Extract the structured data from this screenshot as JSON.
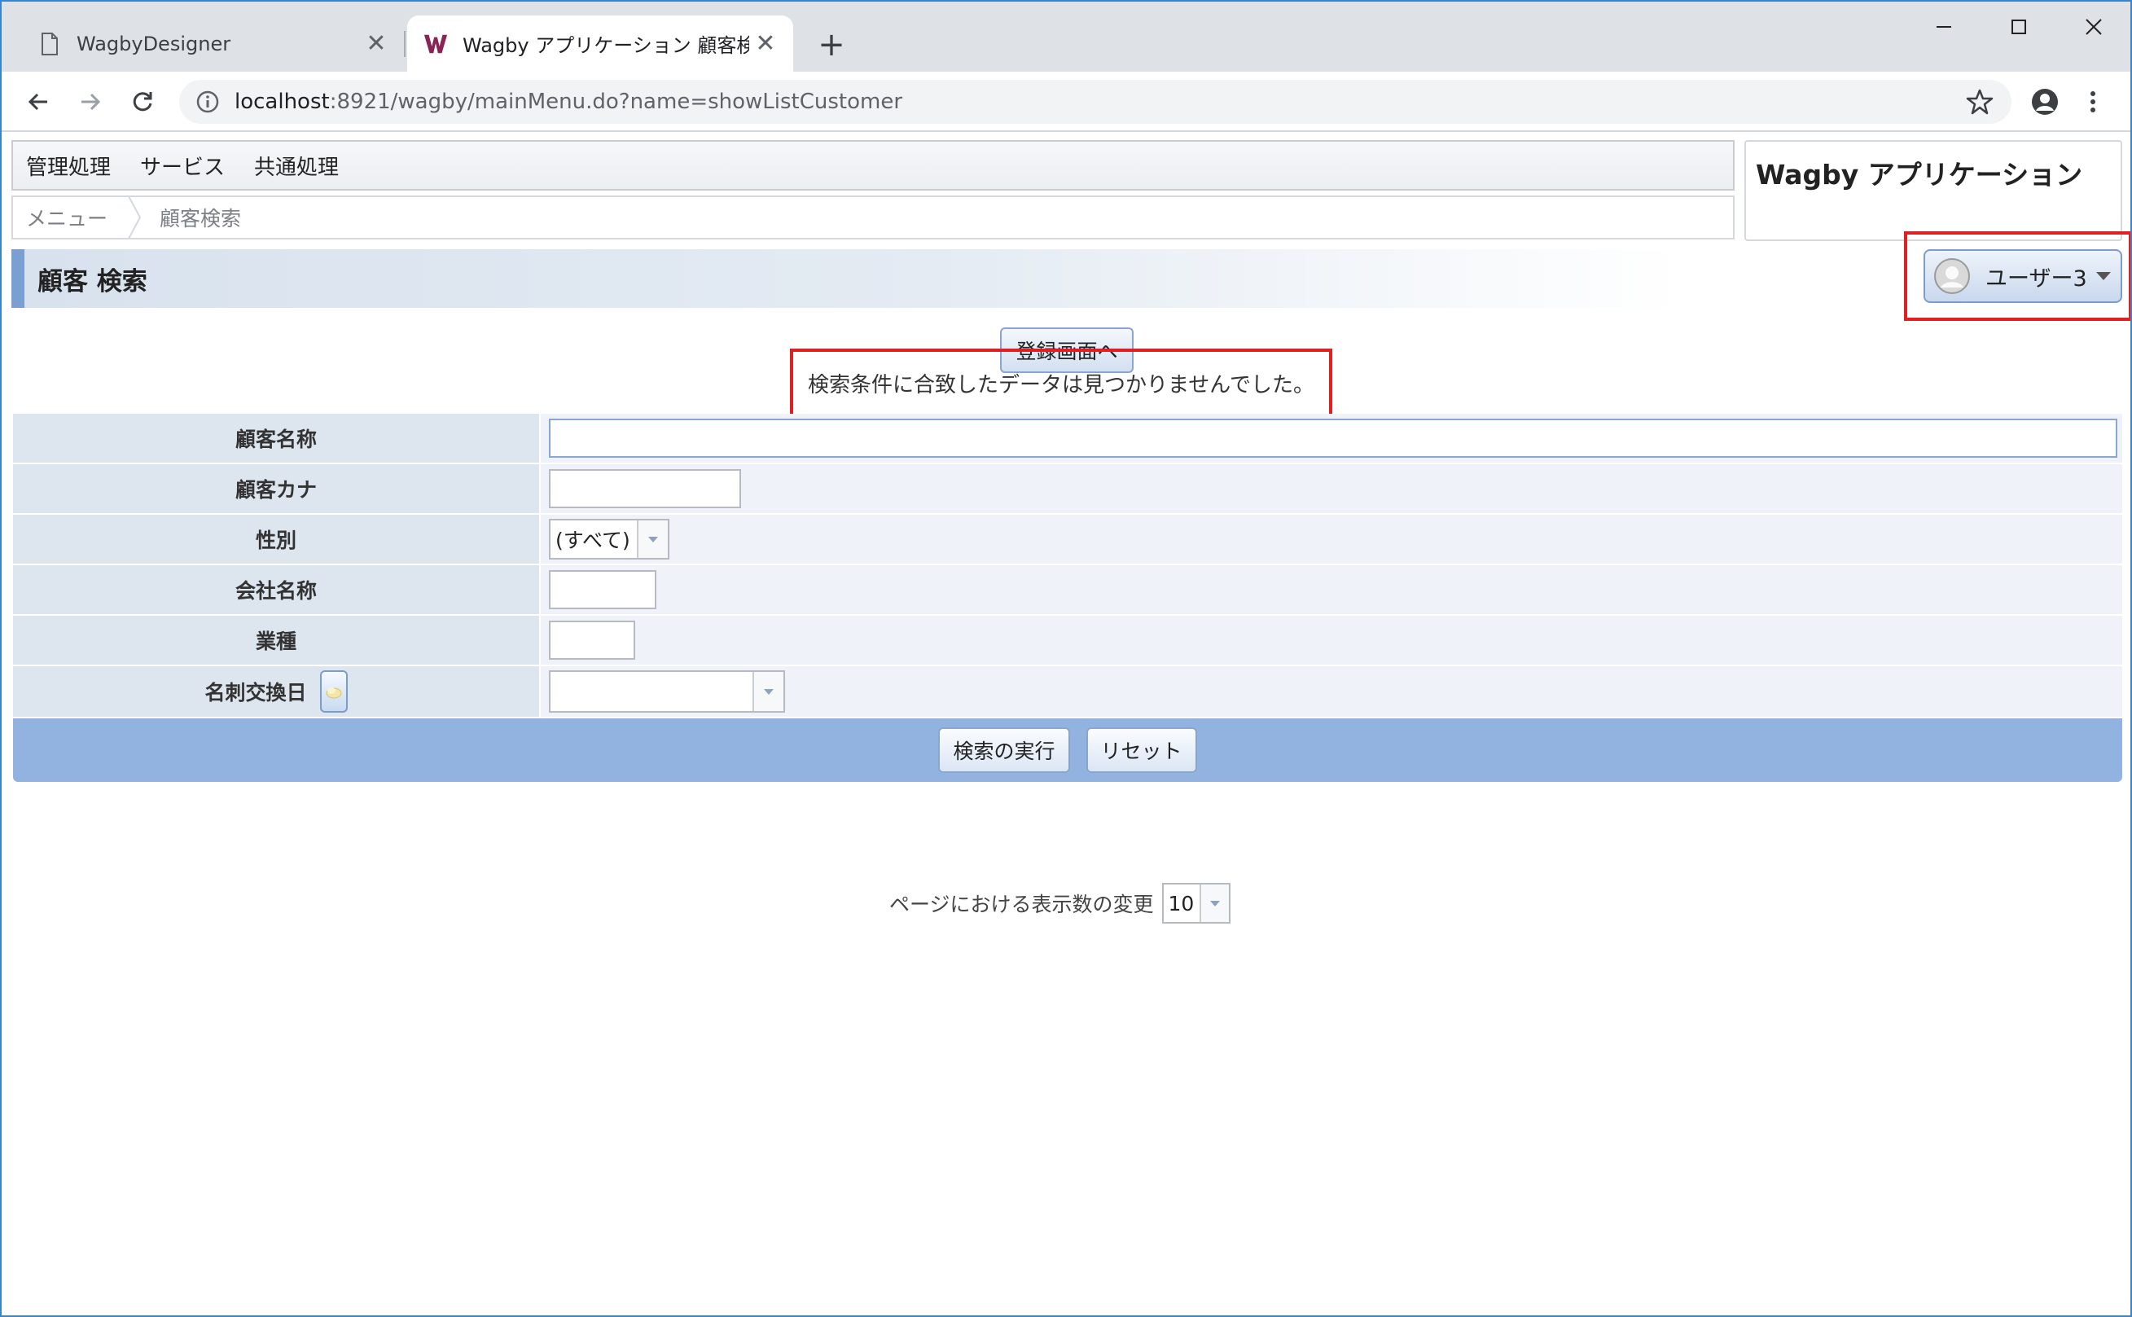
{
  "browser": {
    "tabs": [
      {
        "title": "WagbyDesigner",
        "active": false
      },
      {
        "title": "Wagby アプリケーション 顧客検索",
        "active": true
      }
    ],
    "url_host": "localhost",
    "url_rest": ":8921/wagby/mainMenu.do?name=showListCustomer"
  },
  "menubar": {
    "items": [
      "管理処理",
      "サービス",
      "共通処理"
    ]
  },
  "breadcrumb": {
    "items": [
      "メニュー",
      "顧客検索"
    ]
  },
  "app_title": "Wagby アプリケーション",
  "page_title": "顧客 検索",
  "user": {
    "name": "ユーザー3"
  },
  "register_button": "登録画面へ",
  "message": "検索条件に合致したデータは見つかりませんでした。",
  "search_form": {
    "fields": [
      {
        "label": "顧客名称",
        "value": ""
      },
      {
        "label": "顧客カナ",
        "value": ""
      },
      {
        "label": "性別",
        "value": "(すべて)"
      },
      {
        "label": "会社名称",
        "value": ""
      },
      {
        "label": "業種",
        "value": ""
      },
      {
        "label": "名刺交換日",
        "value": ""
      }
    ],
    "submit_label": "検索の実行",
    "reset_label": "リセット"
  },
  "page_size": {
    "label": "ページにおける表示数の変更",
    "value": "10"
  },
  "colors": {
    "highlight": "#e02020",
    "form_label_bg": "#dde5ef",
    "form_actions_bg": "#92b3e0",
    "title_accent": "#7aa0d2"
  }
}
